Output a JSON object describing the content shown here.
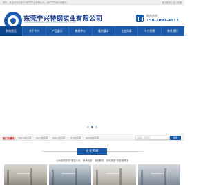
{
  "topbar": {
    "welcome": "您好，欢迎光临东莞宁兴特钢实业有限公司，我们将竭诚为您服务！",
    "links": "设为首页 | 加入收藏"
  },
  "header": {
    "logo_text": "NINGXING",
    "company_name": "东莞宁兴特钢实业有限公司",
    "company_en": "DONGGUAN NINGXING SPECIAL STEEL INDUSTRY CO.,LTD",
    "hotline_label": "服务热线：",
    "hotline_number": "158-2091-4113"
  },
  "nav": {
    "items": [
      {
        "label": "网站首页",
        "active": true
      },
      {
        "label": "关于宁兴"
      },
      {
        "label": "产品展示"
      },
      {
        "label": "新闻中心"
      },
      {
        "label": "案例展示"
      },
      {
        "label": "企业风采"
      },
      {
        "label": "人才招聘"
      },
      {
        "label": "联系我们"
      }
    ]
  },
  "carousel": {
    "slides": 3,
    "active_index": 1
  },
  "hotbar": {
    "label": "热门关键词：",
    "keywords": [
      "SKD11模具钢",
      "DC53模具钢",
      "SKH-9高速钢",
      "H13模具钢",
      "NAK80模具钢"
    ],
    "search_placeholder": "请输入关键字",
    "search_button": "搜索"
  },
  "section": {
    "title": "企业风采",
    "intro": "公司始终坚持“质量为本，技术创新，诚信服务，持续改进”的经营理念"
  }
}
